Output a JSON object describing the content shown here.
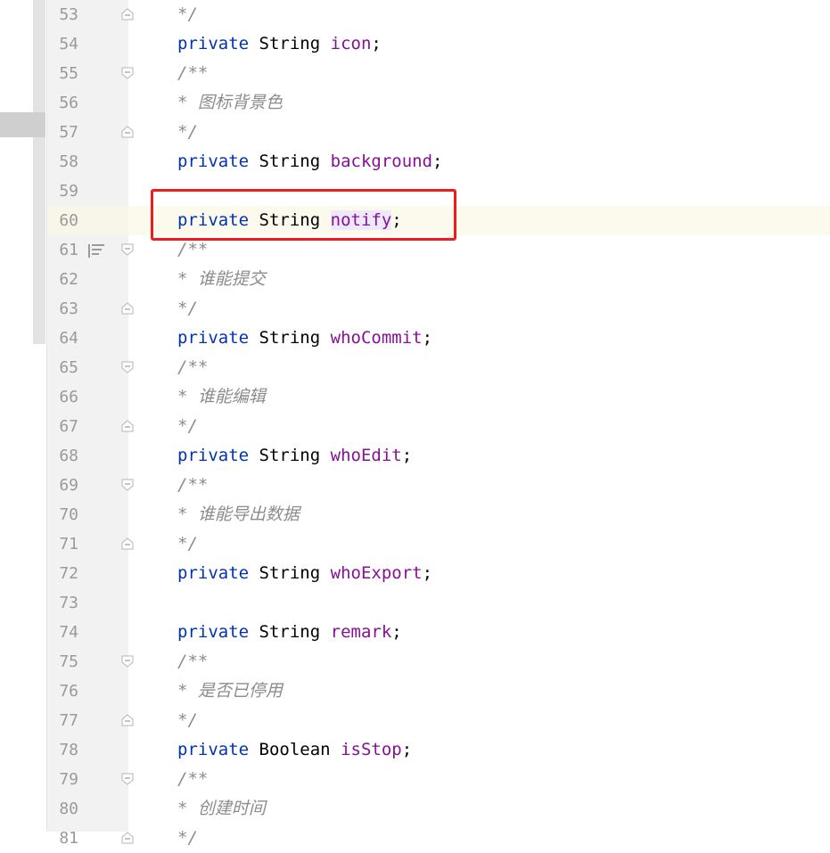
{
  "editor": {
    "lines": [
      {
        "n": "53",
        "type": "comment",
        "text": "*/",
        "fold": "end"
      },
      {
        "n": "54",
        "type": "field",
        "kw": "private",
        "type_name": "String",
        "field": "icon",
        "semi": ";"
      },
      {
        "n": "55",
        "type": "comment",
        "text": "/**",
        "fold": "start"
      },
      {
        "n": "56",
        "type": "comment",
        "text": "* 图标背景色"
      },
      {
        "n": "57",
        "type": "comment",
        "text": "*/",
        "fold": "end"
      },
      {
        "n": "58",
        "type": "field",
        "kw": "private",
        "type_name": "String",
        "field": "background",
        "semi": ";"
      },
      {
        "n": "59",
        "type": "blank"
      },
      {
        "n": "60",
        "type": "field",
        "kw": "private",
        "type_name": "String",
        "field": "notify",
        "semi": ";",
        "current": true
      },
      {
        "n": "61",
        "type": "comment",
        "text": "/**",
        "fold": "start",
        "doc_icon": true
      },
      {
        "n": "62",
        "type": "comment",
        "text": "* 谁能提交"
      },
      {
        "n": "63",
        "type": "comment",
        "text": "*/",
        "fold": "end"
      },
      {
        "n": "64",
        "type": "field",
        "kw": "private",
        "type_name": "String",
        "field": "whoCommit",
        "semi": ";"
      },
      {
        "n": "65",
        "type": "comment",
        "text": "/**",
        "fold": "start"
      },
      {
        "n": "66",
        "type": "comment",
        "text": "* 谁能编辑"
      },
      {
        "n": "67",
        "type": "comment",
        "text": "*/",
        "fold": "end"
      },
      {
        "n": "68",
        "type": "field",
        "kw": "private",
        "type_name": "String",
        "field": "whoEdit",
        "semi": ";"
      },
      {
        "n": "69",
        "type": "comment",
        "text": "/**",
        "fold": "start"
      },
      {
        "n": "70",
        "type": "comment",
        "text": "* 谁能导出数据"
      },
      {
        "n": "71",
        "type": "comment",
        "text": "*/",
        "fold": "end"
      },
      {
        "n": "72",
        "type": "field",
        "kw": "private",
        "type_name": "String",
        "field": "whoExport",
        "semi": ";"
      },
      {
        "n": "73",
        "type": "blank"
      },
      {
        "n": "74",
        "type": "field",
        "kw": "private",
        "type_name": "String",
        "field": "remark",
        "semi": ";"
      },
      {
        "n": "75",
        "type": "comment",
        "text": "/**",
        "fold": "start"
      },
      {
        "n": "76",
        "type": "comment",
        "text": "* 是否已停用"
      },
      {
        "n": "77",
        "type": "comment",
        "text": "*/",
        "fold": "end"
      },
      {
        "n": "78",
        "type": "field",
        "kw": "private",
        "type_name": "Boolean",
        "field": "isStop",
        "semi": ";"
      },
      {
        "n": "79",
        "type": "comment",
        "text": "/**",
        "fold": "start"
      },
      {
        "n": "80",
        "type": "comment",
        "text": "* 创建时间"
      },
      {
        "n": "81",
        "type": "comment",
        "text": "*/",
        "fold": "end"
      }
    ],
    "highlighted_line": "60",
    "colors": {
      "keyword": "#0033b3",
      "field": "#871094",
      "comment": "#8c8c8c",
      "highlight_box": "#ee1c1c",
      "current_line": "#fcfaed"
    }
  }
}
